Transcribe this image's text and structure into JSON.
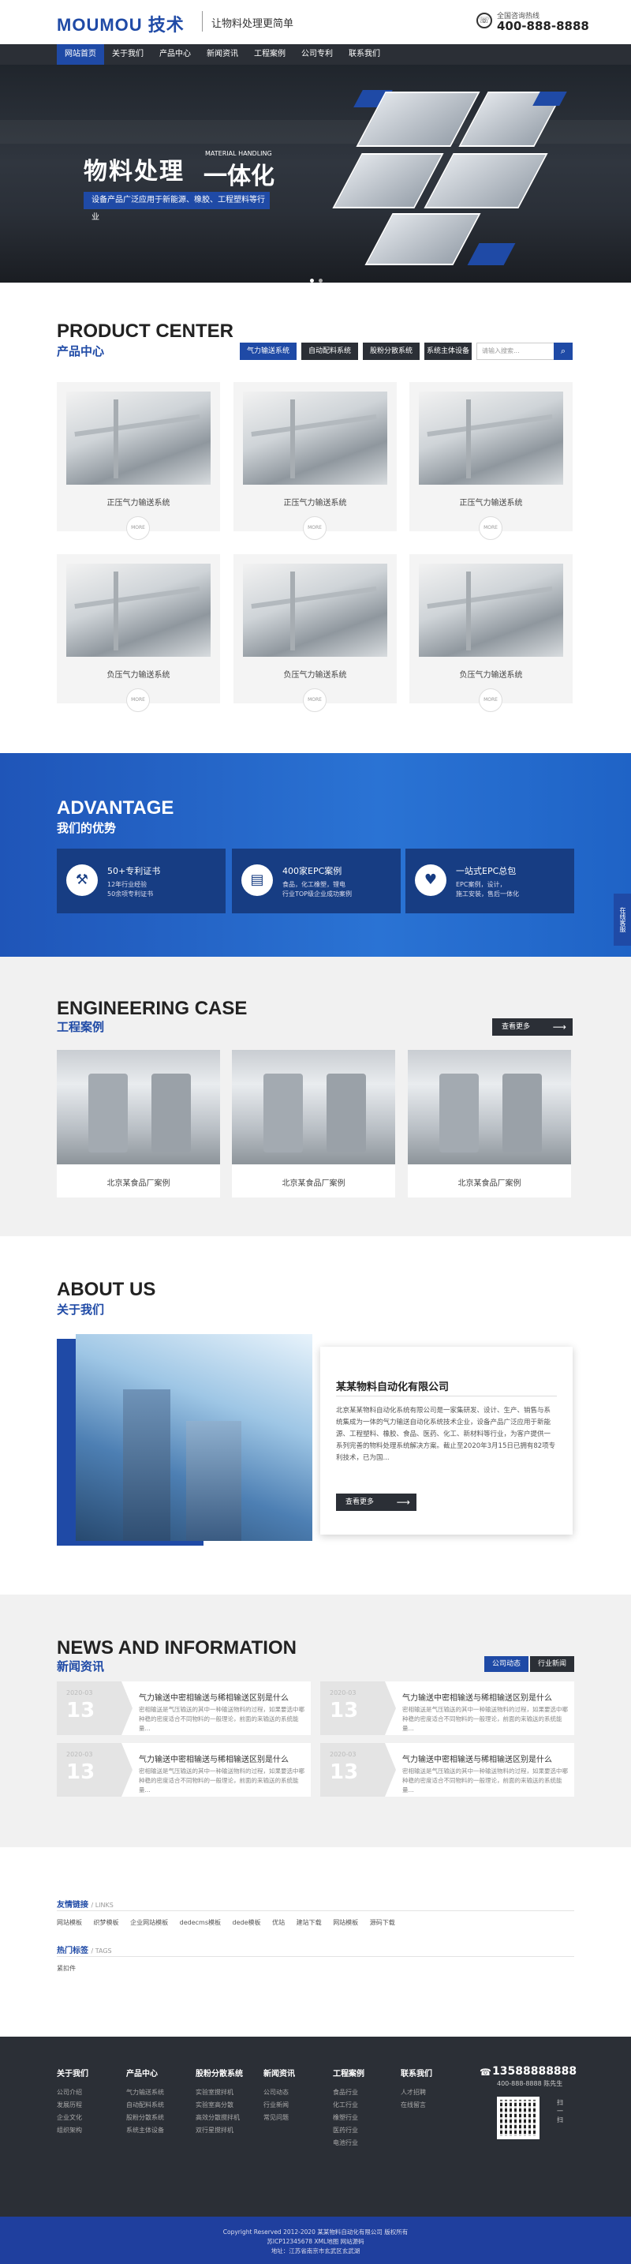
{
  "header": {
    "logo": "MOUMOU 技术",
    "slogan": "让物料处理更简单",
    "phone_label": "全国咨询热线",
    "phone": "400-888-8888"
  },
  "nav": [
    "网站首页",
    "关于我们",
    "产品中心",
    "新闻资讯",
    "工程案例",
    "公司专利",
    "联系我们"
  ],
  "banner": {
    "title_a": "物料处理",
    "title_b": "一体化",
    "title_en": "MATERIAL HANDLING",
    "tagline": "设备产品广泛应用于新能源、橡胶、工程塑料等行业"
  },
  "product": {
    "en": "PRODUCT CENTER",
    "cn": "产品中心",
    "tabs": [
      "气力输送系统",
      "自动配料系统",
      "股粉分散系统",
      "系统主体设备"
    ],
    "search_placeholder": "请输入搜索...",
    "more": "MORE",
    "items": [
      "正压气力输送系统",
      "正压气力输送系统",
      "正压气力输送系统",
      "负压气力输送系统",
      "负压气力输送系统",
      "负压气力输送系统"
    ]
  },
  "advantage": {
    "en": "ADVANTAGE",
    "cn": "我们的优势",
    "items": [
      {
        "title": "50+专利证书",
        "d1": "12年行业经验",
        "d2": "50余项专利证书"
      },
      {
        "title": "400家EPC案例",
        "d1": "食品，化工橡塑，锂电",
        "d2": "行业TOP级企业成功案例"
      },
      {
        "title": "一站式EPC总包",
        "d1": "EPC案例，设计，",
        "d2": "施工安装，售后一体化"
      }
    ],
    "side": "在线客服"
  },
  "case": {
    "en": "ENGINEERING CASE",
    "cn": "工程案例",
    "more": "查看更多",
    "items": [
      "北京某食品厂案例",
      "北京某食品厂案例",
      "北京某食品厂案例"
    ]
  },
  "about": {
    "en": "ABOUT US",
    "cn": "关于我们",
    "company": "某某物料自动化有限公司",
    "desc": "北京某某物料自动化系统有限公司是一家集研发、设计、生产、销售与系统集成为一体的气力输送自动化系统技术企业，设备产品广泛应用于新能源、工程塑料、橡胶、食品、医药、化工、新材料等行业，为客户提供一系列完善的物料处理系统解决方案。截止至2020年3月15日已拥有82项专利技术，已为国...",
    "more": "查看更多"
  },
  "news": {
    "en": "NEWS AND INFORMATION",
    "cn": "新闻资讯",
    "tabs": [
      "公司动态",
      "行业新闻"
    ],
    "items": [
      {
        "ym": "2020-03",
        "day": "13",
        "title": "气力输送中密相输送与稀相输送区别是什么",
        "desc": "密相输送是气压输送的其中一种输送物料的过程，如果要选中哪种稳的密度适合不同物料的一般理论，前面的来输送的系统能量..."
      },
      {
        "ym": "2020-03",
        "day": "13",
        "title": "气力输送中密相输送与稀相输送区别是什么",
        "desc": "密相输送是气压输送的其中一种输送物料的过程，如果要选中哪种稳的密度适合不同物料的一般理论，前面的来输送的系统能量..."
      },
      {
        "ym": "2020-03",
        "day": "13",
        "title": "气力输送中密相输送与稀相输送区别是什么",
        "desc": "密相输送是气压输送的其中一种输送物料的过程，如果要选中哪种稳的密度适合不同物料的一般理论，前面的来输送的系统能量..."
      },
      {
        "ym": "2020-03",
        "day": "13",
        "title": "气力输送中密相输送与稀相输送区别是什么",
        "desc": "密相输送是气压输送的其中一种输送物料的过程，如果要选中哪种稳的密度适合不同物料的一般理论，前面的来输送的系统能量..."
      }
    ]
  },
  "links": {
    "head": "友情链接",
    "head_en": "/ LINKS",
    "items": [
      "网站模板",
      "织梦模板",
      "企业网站模板",
      "dedecms模板",
      "dede模板",
      "优站",
      "建站下载",
      "网站模板",
      "源码下载"
    ],
    "tags_head": "热门标签",
    "tags_en": "/ TAGS",
    "tag": "紧扣件"
  },
  "footer": {
    "cols": [
      {
        "h": "关于我们",
        "items": [
          "公司介绍",
          "发展历程",
          "企业文化",
          "组织架构"
        ]
      },
      {
        "h": "产品中心",
        "items": [
          "气力输送系统",
          "自动配料系统",
          "股粉分散系统",
          "系统主体设备"
        ]
      },
      {
        "h": "股粉分散系统",
        "items": [
          "实验室搅拌机",
          "实验室高分散",
          "高效分散搅拌机",
          "双行星搅拌机"
        ]
      },
      {
        "h": "新闻资讯",
        "items": [
          "公司动态",
          "行业新闻",
          "常见问题"
        ]
      },
      {
        "h": "工程案例",
        "items": [
          "食品行业",
          "化工行业",
          "橡塑行业",
          "医药行业",
          "电池行业"
        ]
      },
      {
        "h": "联系我们",
        "items": [
          "人才招聘",
          "在线留言"
        ]
      }
    ],
    "tel": "13588888888",
    "tel2": "400-888-8888 陈先生",
    "qr_text": "扫一扫"
  },
  "copyright": {
    "l1": "Copyright Reserved 2012-2020 某某物料自动化有限公司 版权所有",
    "l2": "苏ICP12345678 XML地图 网站源码",
    "l3": "地址：江苏省南京市玄武区玄武湖"
  }
}
